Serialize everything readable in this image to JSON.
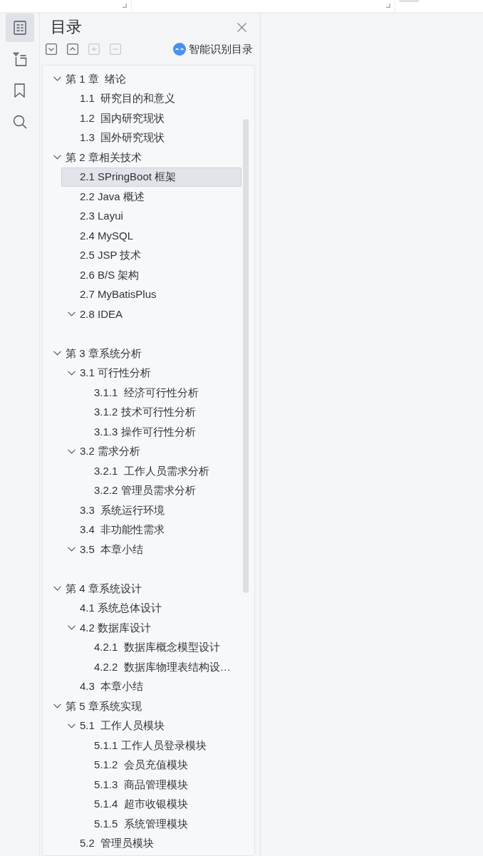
{
  "rail_tabs": [
    {
      "selected": true
    },
    {
      "selected": false
    },
    {
      "selected": false
    },
    {
      "selected": false
    }
  ],
  "panel": {
    "title": "目录",
    "smart_button": "智能识别目录"
  },
  "toolbar_buttons": [
    {
      "disabled": false
    },
    {
      "disabled": false
    },
    {
      "disabled": true
    },
    {
      "disabled": true
    }
  ],
  "toc": [
    {
      "title": "第 1 章  绪论",
      "expanded": true,
      "selected": false,
      "children": [
        {
          "title": "1.1  研究目的和意义",
          "selected": false
        },
        {
          "title": "1.2  国内研究现状",
          "selected": false
        },
        {
          "title": "1.3  国外研究现状",
          "selected": false
        }
      ]
    },
    {
      "title": "第 2 章相关技术",
      "expanded": true,
      "selected": false,
      "children": [
        {
          "title": "2.1 SPringBoot 框架",
          "selected": true
        },
        {
          "title": "2.2 Java 概述",
          "selected": false
        },
        {
          "title": "2.3 Layui",
          "selected": false
        },
        {
          "title": "2.4 MySQL",
          "selected": false
        },
        {
          "title": "2.5 JSP 技术",
          "selected": false
        },
        {
          "title": "2.6 B/S 架构",
          "selected": false
        },
        {
          "title": "2.7 MyBatisPlus",
          "selected": false
        },
        {
          "title": "2.8 IDEA",
          "expanded": true,
          "selected": false
        }
      ]
    },
    {
      "title": "第 3 章系统分析",
      "expanded": true,
      "selected": false,
      "children": [
        {
          "title": "3.1 可行性分析",
          "expanded": true,
          "selected": false,
          "children": [
            {
              "title": "3.1.1  经济可行性分析",
              "selected": false
            },
            {
              "title": "3.1.2 技术可行性分析",
              "selected": false
            },
            {
              "title": "3.1.3 操作可行性分析",
              "selected": false
            }
          ]
        },
        {
          "title": "3.2 需求分析",
          "expanded": true,
          "selected": false,
          "children": [
            {
              "title": "3.2.1  工作人员需求分析",
              "selected": false
            },
            {
              "title": "3.2.2 管理员需求分析",
              "selected": false
            }
          ]
        },
        {
          "title": "3.3  系统运行环境",
          "selected": false
        },
        {
          "title": "3.4  非功能性需求",
          "selected": false
        },
        {
          "title": "3.5  本章小结",
          "expanded": true,
          "selected": false
        }
      ]
    },
    {
      "title": "第 4 章系统设计",
      "expanded": true,
      "selected": false,
      "children": [
        {
          "title": "4.1 系统总体设计",
          "selected": false
        },
        {
          "title": "4.2 数据库设计",
          "expanded": true,
          "selected": false,
          "children": [
            {
              "title": "4.2.1  数据库概念模型设计",
              "selected": false
            },
            {
              "title": "4.2.2  数据库物理表结构设…",
              "selected": false
            }
          ]
        },
        {
          "title": "4.3  本章小结",
          "selected": false
        }
      ]
    },
    {
      "title": "第 5 章系统实现",
      "expanded": true,
      "selected": false,
      "children": [
        {
          "title": "5.1  工作人员模块",
          "expanded": true,
          "selected": false,
          "children": [
            {
              "title": "5.1.1 工作人员登录模块",
              "selected": false
            },
            {
              "title": "5.1.2  会员充值模块",
              "selected": false
            },
            {
              "title": "5.1.3  商品管理模块",
              "selected": false
            },
            {
              "title": "5.1.4  超市收银模块",
              "selected": false
            },
            {
              "title": "5.1.5  系统管理模块",
              "selected": false
            }
          ]
        },
        {
          "title": "5.2  管理员模块",
          "selected": false
        }
      ]
    }
  ]
}
